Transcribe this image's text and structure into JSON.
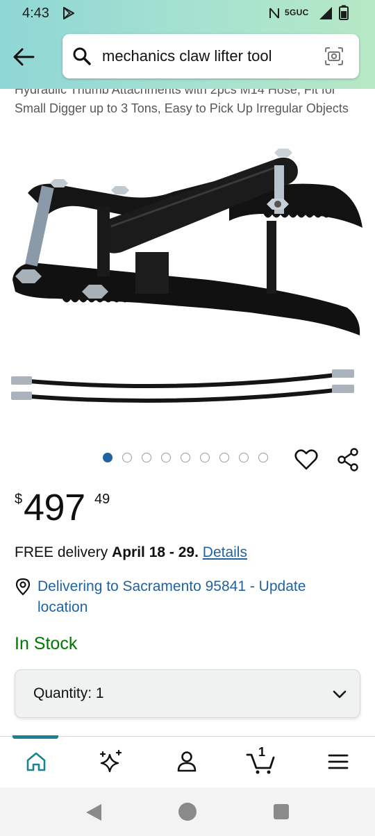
{
  "status_bar": {
    "time": "4:43",
    "network": "5GUC"
  },
  "search": {
    "query": "mechanics claw lifter tool"
  },
  "product": {
    "title": "Hydraulic Thumb Attachments with 2pcs M14 Hose, Fit for Small Digger up to 3 Tons, Easy to Pick Up Irregular Objects",
    "image_count": 9,
    "active_image_index": 0,
    "price": {
      "currency": "$",
      "whole": "497",
      "fraction": "49"
    },
    "delivery": {
      "prefix": "FREE delivery ",
      "dates": "April 18 - 29.",
      "details_link": "Details"
    },
    "location": {
      "text": "Delivering to Sacramento 95841 - Update location"
    },
    "stock": "In Stock",
    "quantity": {
      "label": "Quantity:",
      "value": "1"
    }
  },
  "bottom_nav": {
    "cart_count": "1",
    "active_tab": "home"
  },
  "colors": {
    "link": "#2162a1",
    "in_stock": "#007600",
    "header_gradient_start": "#8fd6d6",
    "header_gradient_end": "#b7e8c6",
    "nav_indicator": "#1a8292"
  }
}
